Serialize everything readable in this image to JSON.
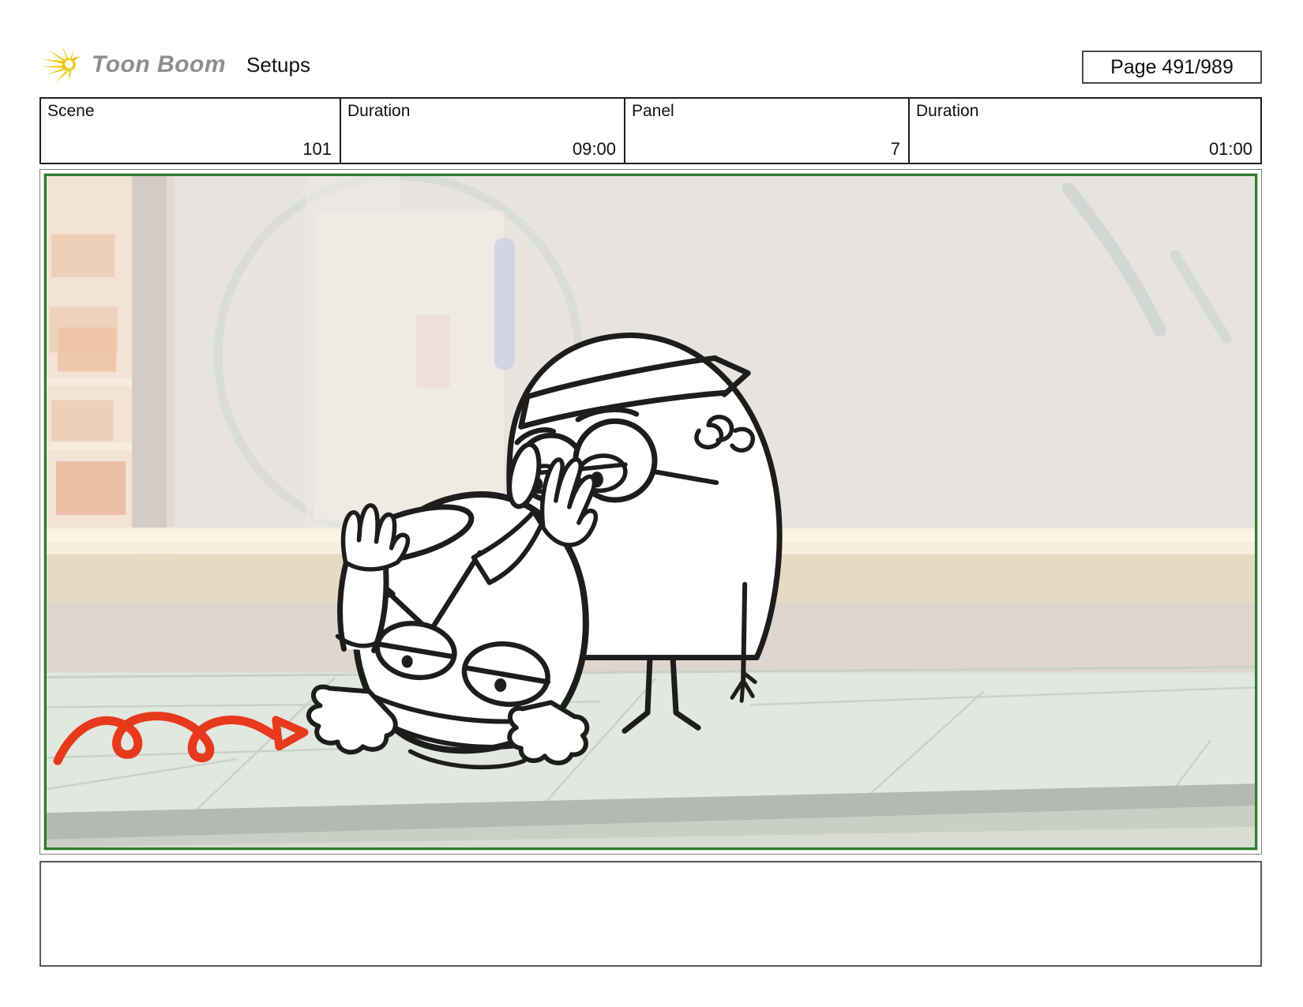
{
  "header": {
    "brand": "Toon Boom",
    "section": "Setups",
    "page_label": "Page 491/989"
  },
  "info_row": {
    "cells": [
      {
        "label": "Scene",
        "value": "101"
      },
      {
        "label": "Duration",
        "value": "09:00"
      },
      {
        "label": "Panel",
        "value": "7"
      },
      {
        "label": "Duration",
        "value": "01:00"
      }
    ]
  },
  "panel": {
    "caption": "",
    "description": "Storyboard sketch: bespectacled egg-shaped character with headband looks down at friend doing an upside-down headstand; red bouncing spiral motion arrow at lower left"
  },
  "colors": {
    "frame_green": "#2e7d2e",
    "motion_arrow_red": "#e8391c",
    "logo_yellow": "#f2c50a",
    "brand_gray": "#8e8e8e",
    "sketch_ink": "#1d1d1d"
  },
  "icons": {
    "logo": "toonboom-starburst-icon"
  }
}
